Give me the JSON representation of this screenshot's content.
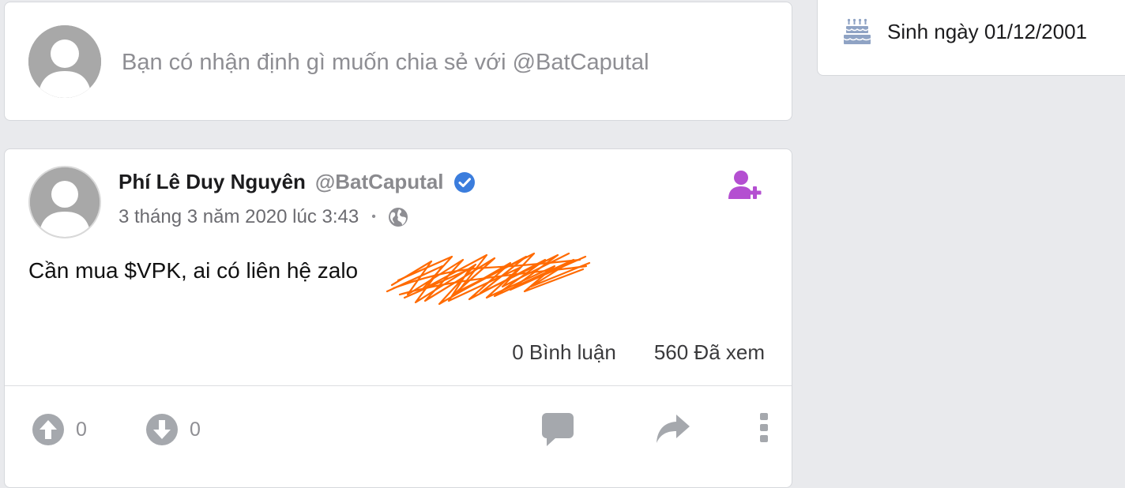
{
  "composer": {
    "placeholder": "Bạn có nhận định gì muốn chia sẻ với @BatCaputal"
  },
  "post": {
    "author_name": "Phí Lê Duy Nguyên",
    "author_handle": "@BatCaputal",
    "timestamp": "3 tháng 3 năm 2020 lúc 3:43",
    "meta_separator": "•",
    "text": "Cần mua $VPK, ai có liên hệ zalo",
    "comments_label": "0 Bình luận",
    "views_label": "560 Đã xem",
    "upvotes": "0",
    "downvotes": "0"
  },
  "about": {
    "birthday": "Sinh ngày 01/12/2001"
  },
  "icons": {
    "verified": "verified-check-icon",
    "privacy": "globe-icon",
    "follow": "add-user-icon",
    "upvote": "arrow-up-circle-icon",
    "downvote": "arrow-down-circle-icon",
    "comment": "comment-bubble-icon",
    "share": "share-arrow-icon",
    "more": "more-vertical-icon",
    "birthday": "birthday-cake-icon"
  },
  "colors": {
    "background": "#e9eaed",
    "verified": "#3b7ddd",
    "follow": "#b44fd1",
    "action_icon": "#a5a8ad",
    "redaction": "#ff6a00"
  }
}
